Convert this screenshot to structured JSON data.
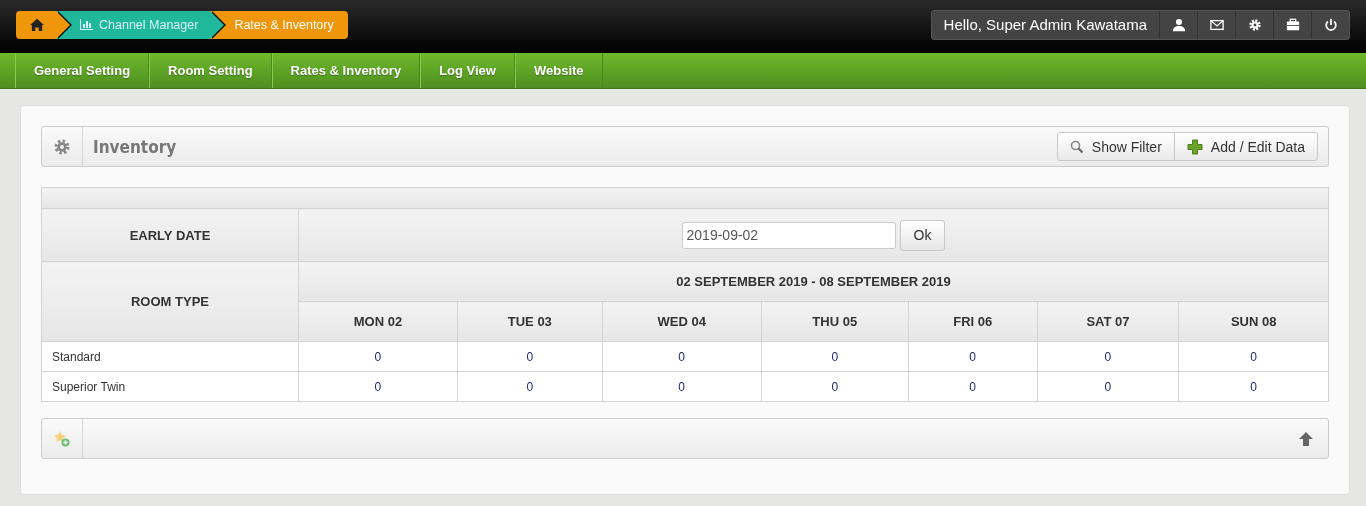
{
  "breadcrumbs": [
    {
      "kind": "home"
    },
    {
      "kind": "chart",
      "label": "Channel Manager"
    },
    {
      "kind": "current",
      "label": "Rates & Inventory"
    }
  ],
  "greeting": "Hello, Super Admin Kawatama",
  "user_tools": [
    {
      "kind": "user"
    },
    {
      "kind": "mail"
    },
    {
      "kind": "settings"
    },
    {
      "kind": "briefcase"
    },
    {
      "kind": "power"
    }
  ],
  "nav": [
    {
      "label": "General Setting"
    },
    {
      "label": "Room Setting"
    },
    {
      "label": "Rates & Inventory"
    },
    {
      "label": "Log View"
    },
    {
      "label": "Website"
    }
  ],
  "panel": {
    "title": "Inventory",
    "buttons": [
      {
        "kind": "search",
        "label": "Show Filter"
      },
      {
        "kind": "add",
        "label": "Add / Edit Data"
      }
    ]
  },
  "table": {
    "early_date_label": "EARLY DATE",
    "date_value": "2019-09-02",
    "ok": "Ok",
    "room_type_label": "ROOM TYPE",
    "range": "02 SEPTEMBER 2019 - 08 SEPTEMBER 2019",
    "days": [
      "MON 02",
      "TUE 03",
      "WED 04",
      "THU 05",
      "FRI 06",
      "SAT 07",
      "SUN 08"
    ],
    "rows": [
      {
        "room": "Standard",
        "values": [
          "0",
          "0",
          "0",
          "0",
          "0",
          "0",
          "0"
        ]
      },
      {
        "room": "Superior Twin",
        "values": [
          "0",
          "0",
          "0",
          "0",
          "0",
          "0",
          "0"
        ]
      }
    ]
  }
}
